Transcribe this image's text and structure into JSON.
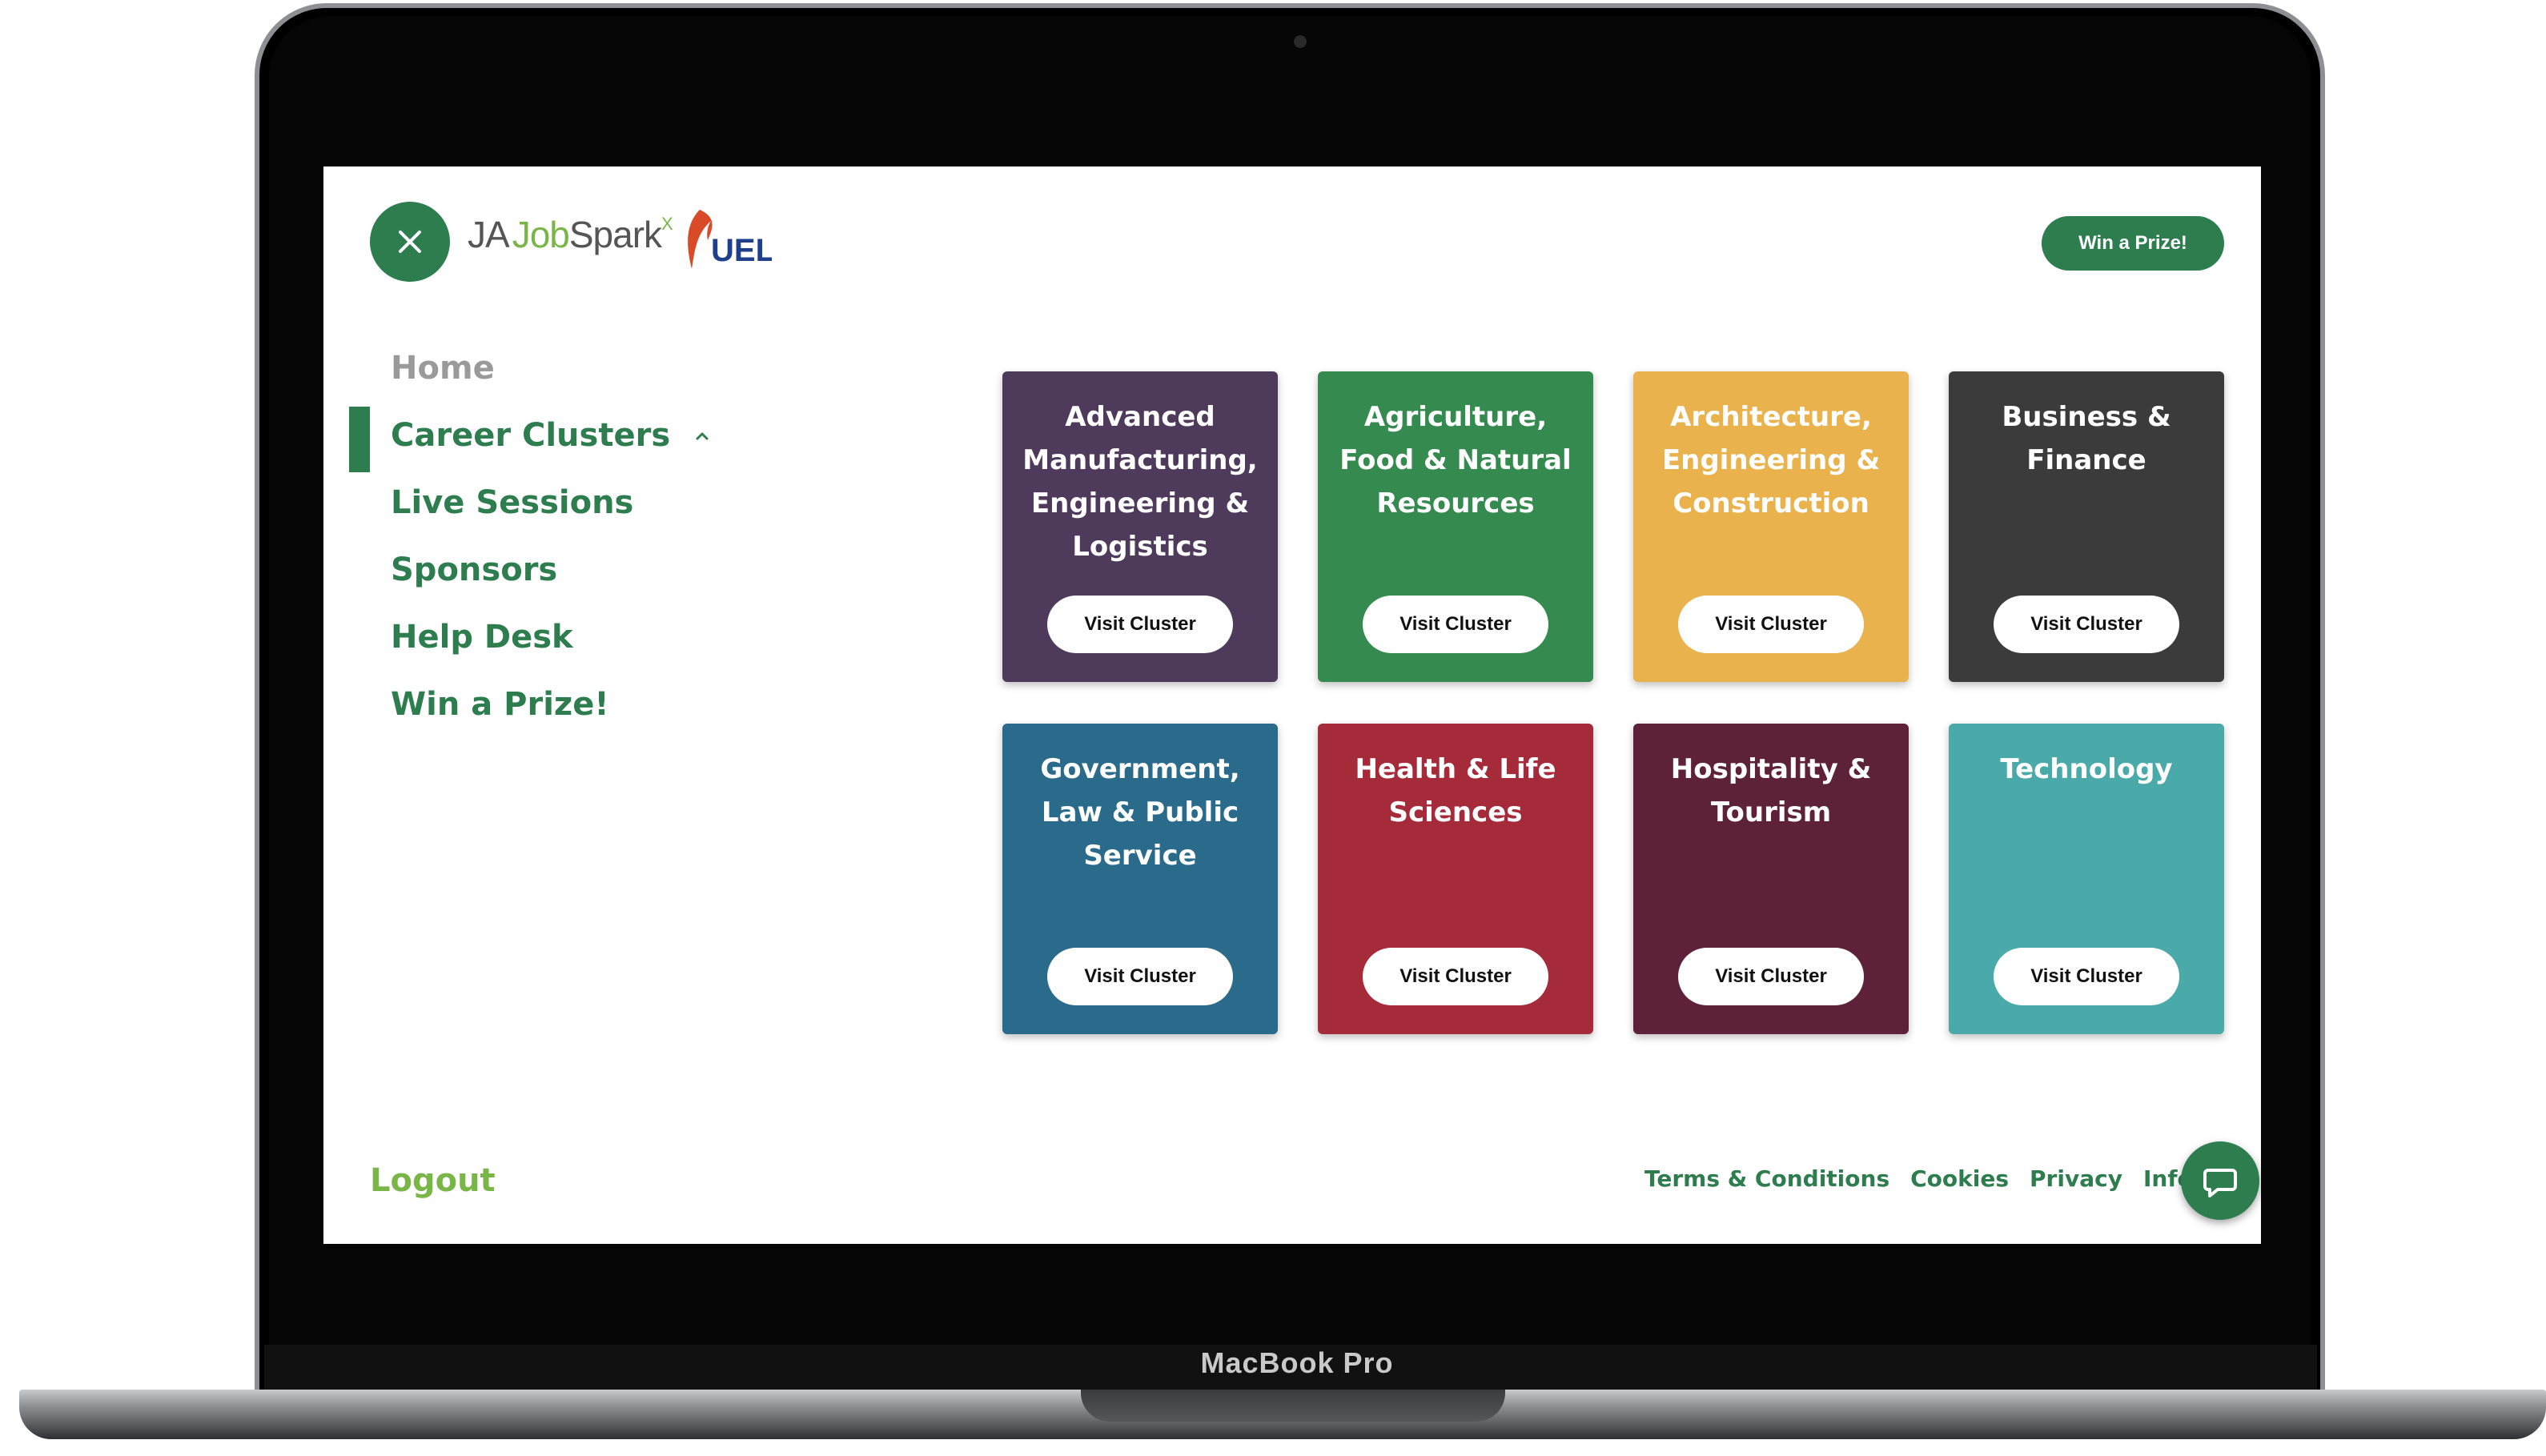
{
  "device": {
    "brand_label": "MacBook Pro"
  },
  "header": {
    "logo_ja": "JA",
    "logo_job": "Job",
    "logo_spark": "Spark",
    "logo_x": "X",
    "partner_logo_text": "UEL",
    "prize_button_label": "Win a Prize!",
    "close_icon": "close-icon"
  },
  "nav": {
    "items": [
      {
        "label": "Home"
      },
      {
        "label": "Career Clusters"
      },
      {
        "label": "Live Sessions"
      },
      {
        "label": "Sponsors"
      },
      {
        "label": "Help Desk"
      },
      {
        "label": "Win a Prize!"
      }
    ],
    "active": "Career Clusters"
  },
  "clusters": [
    {
      "title": "Advanced Manufacturing, Engineering & Logistics",
      "button": "Visit Cluster",
      "color": "#4e3a5a"
    },
    {
      "title": "Agriculture, Food & Natural Resources",
      "button": "Visit Cluster",
      "color": "#358a4f"
    },
    {
      "title": "Architecture, Engineering & Construction",
      "button": "Visit Cluster",
      "color": "#e9b24d"
    },
    {
      "title": "Business & Finance",
      "button": "Visit Cluster",
      "color": "#3b3b3b"
    },
    {
      "title": "Government, Law & Public Service",
      "button": "Visit Cluster",
      "color": "#2a6a8a"
    },
    {
      "title": "Health & Life Sciences",
      "button": "Visit Cluster",
      "color": "#a52a3a"
    },
    {
      "title": "Hospitality & Tourism",
      "button": "Visit Cluster",
      "color": "#5e213a"
    },
    {
      "title": "Technology",
      "button": "Visit Cluster",
      "color": "#4aaaa9"
    }
  ],
  "footer": {
    "logout_label": "Logout",
    "links": [
      "Terms & Conditions",
      "Cookies",
      "Privacy",
      "Informa"
    ]
  },
  "colors": {
    "brand_green": "#2e7d4f",
    "accent_lime": "#7ab547"
  }
}
